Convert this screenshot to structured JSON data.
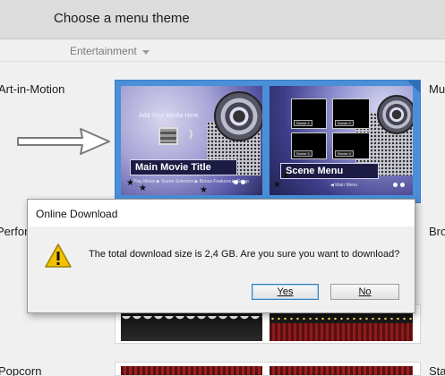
{
  "header": {
    "title": "Choose a menu theme"
  },
  "category": {
    "selected": "Entertainment",
    "icon": "chevron-down-icon"
  },
  "themes": {
    "art_in_motion": {
      "label": "Art-in-Motion",
      "thumb_main": {
        "hint": "Add Your Media Here",
        "title": "Main Movie Title",
        "buttons": "Play Movie  ▶ Scene Selection  ▶ Bonus Features  ▶ Setup"
      },
      "thumb_scene": {
        "title": "Scene Menu",
        "scene_tags": [
          "Scene 1",
          "Scene 2",
          "Scene 3",
          "Scene 4"
        ],
        "nav": "◀  Main Menu"
      }
    },
    "side_labels": {
      "right_1": "Mu",
      "left_2": "Perfor",
      "right_2": "Bro",
      "left_3": "Popcorn",
      "right_3": "Sta"
    }
  },
  "dialog": {
    "title": "Online Download",
    "message": "The total download size is 2,4 GB. Are you sure you want to download?",
    "icon": "warning-icon",
    "yes_label": "Yes",
    "no_label": "No"
  },
  "colors": {
    "selection": "#4a90d9",
    "header_bg": "#dcdcdc",
    "warning": "#f2c200"
  }
}
